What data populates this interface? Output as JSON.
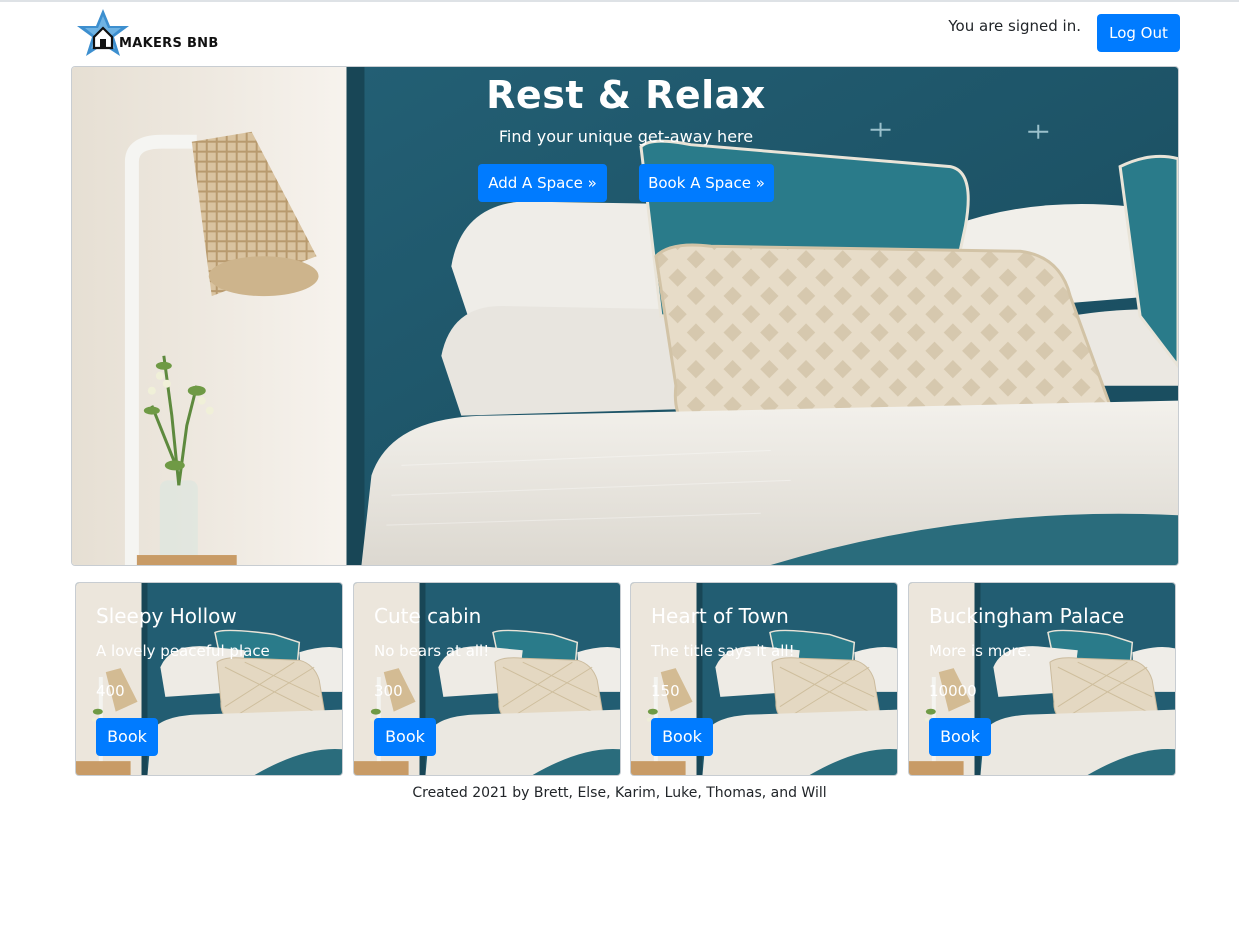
{
  "header": {
    "logo_text": "MAKERS BNB",
    "signed_in_text": "You are signed in.",
    "logout_label": "Log Out"
  },
  "hero": {
    "title": "Rest & Relax",
    "subtitle": "Find your unique get-away here",
    "add_space_label": "Add A Space »",
    "book_space_label": "Book A Space »"
  },
  "spaces": [
    {
      "name": "Sleepy Hollow",
      "description": "A lovely peaceful place",
      "price": "400",
      "button": "Book"
    },
    {
      "name": "Cute cabin",
      "description": "No bears at all!",
      "price": "300",
      "button": "Book"
    },
    {
      "name": "Heart of Town",
      "description": "The title says it all!",
      "price": "150",
      "button": "Book"
    },
    {
      "name": "Buckingham Palace",
      "description": "More is more.",
      "price": "10000",
      "button": "Book"
    }
  ],
  "footer": {
    "credits": "Created 2021 by Brett, Else, Karim, Luke, Thomas, and Will"
  },
  "colors": {
    "primary": "#007bff",
    "headboard": "#1f5f73",
    "wall": "#f1ece4"
  },
  "icons": {
    "logo": "star-house-icon"
  }
}
